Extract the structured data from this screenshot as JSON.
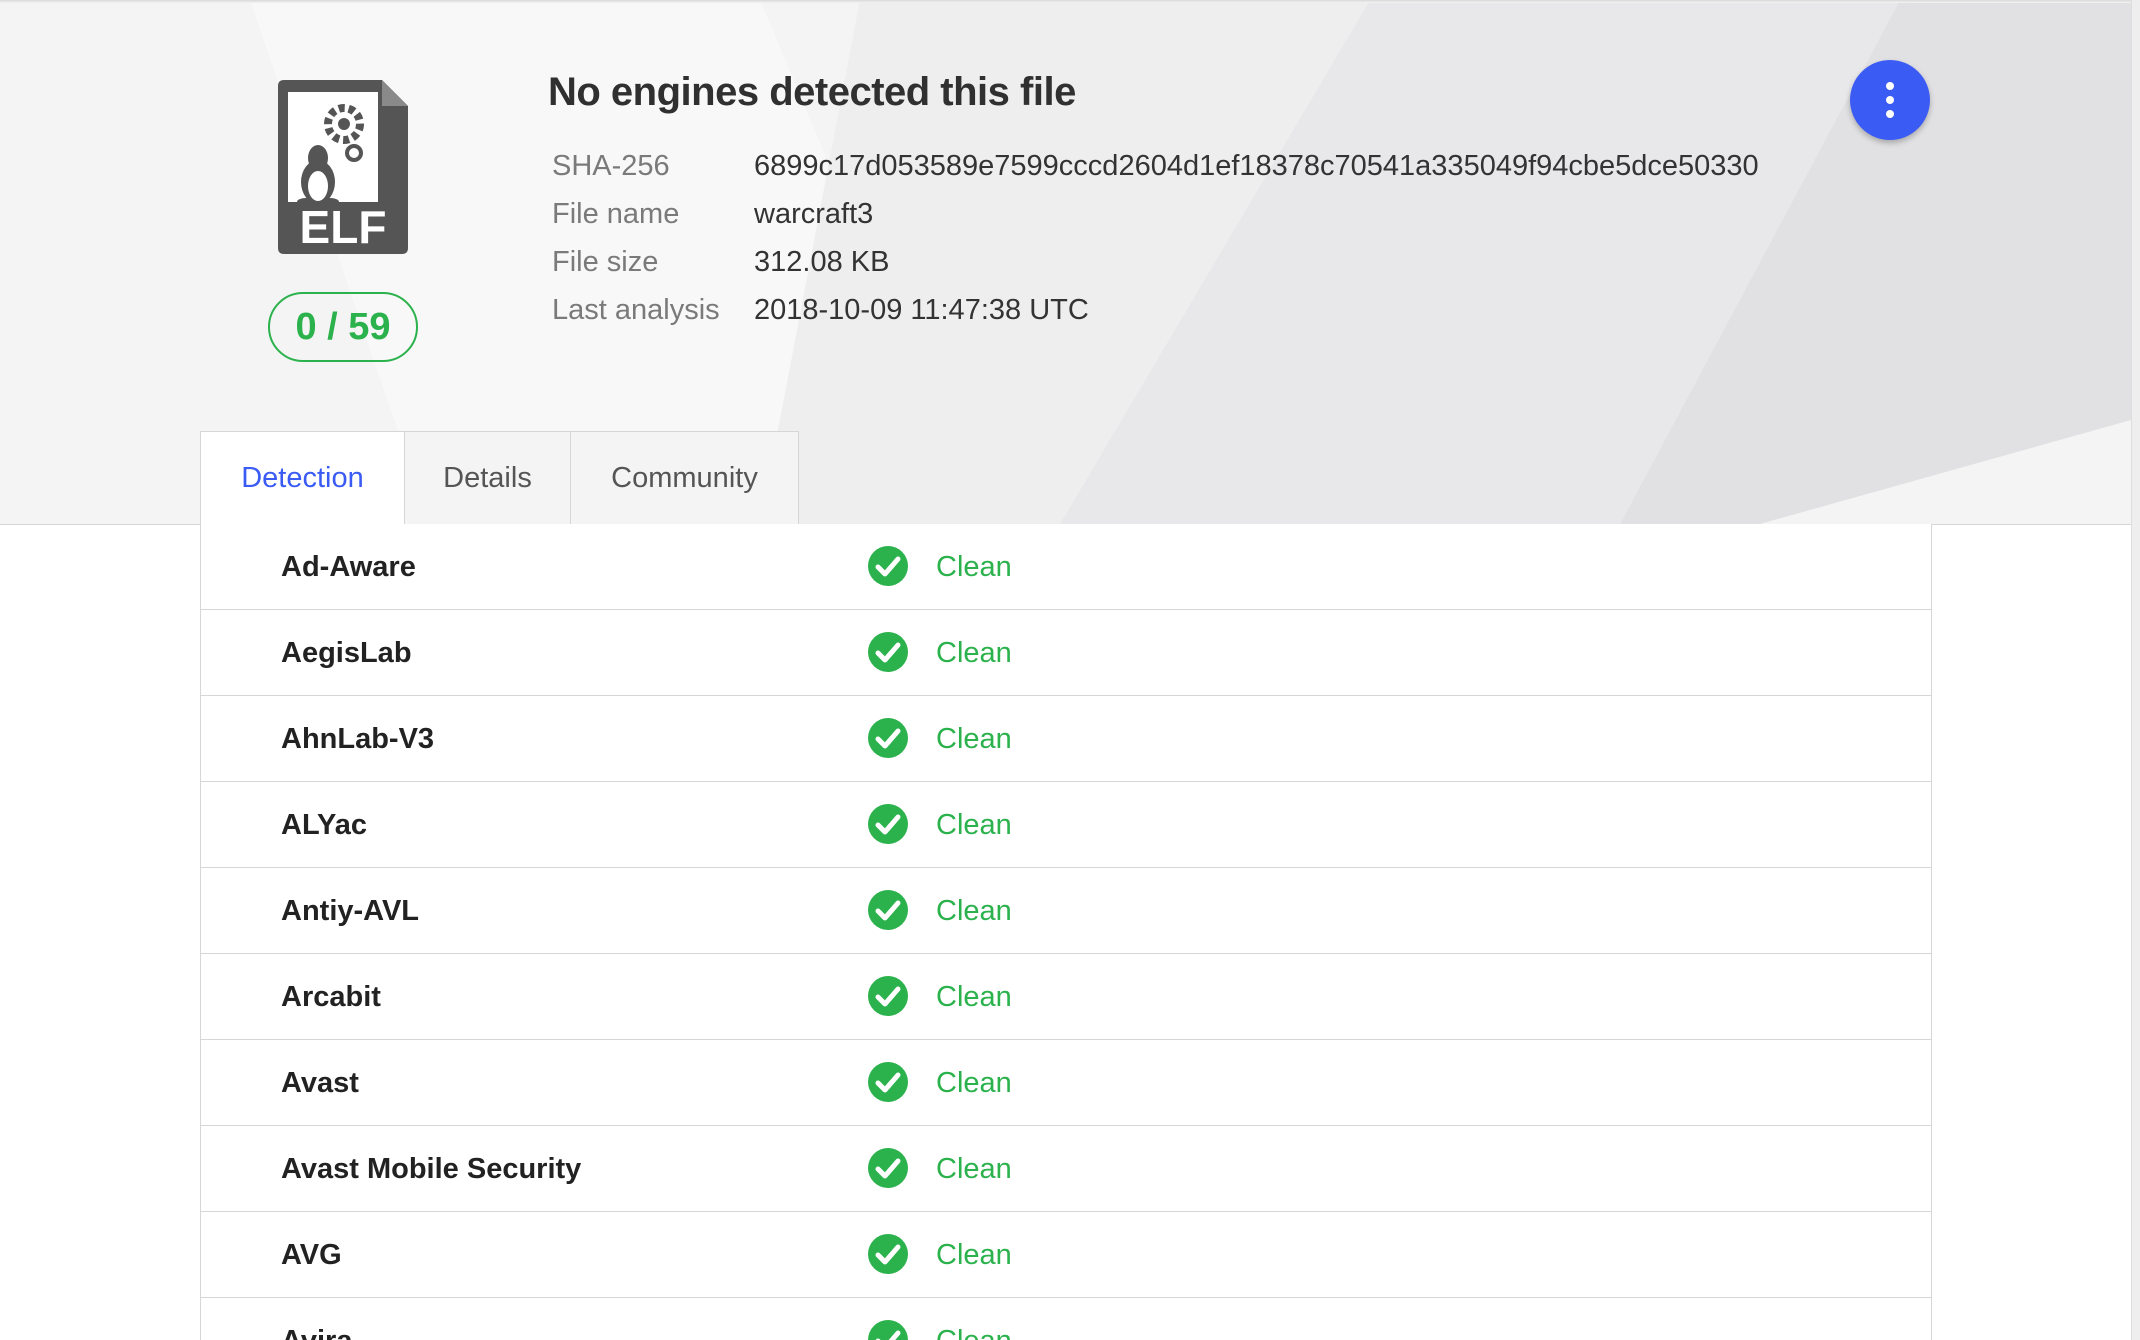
{
  "report": {
    "title": "No engines detected this file",
    "score": "0 / 59",
    "file_type": "ELF",
    "metadata": [
      {
        "label": "SHA-256",
        "value": "6899c17d053589e7599cccd2604d1ef18378c70541a335049f94cbe5dce50330"
      },
      {
        "label": "File name",
        "value": "warcraft3"
      },
      {
        "label": "File size",
        "value": "312.08 KB"
      },
      {
        "label": "Last analysis",
        "value": "2018-10-09 11:47:38 UTC"
      }
    ]
  },
  "actions": {
    "more_icon": "vertical-dots-icon"
  },
  "tabs": [
    {
      "label": "Detection",
      "active": true
    },
    {
      "label": "Details",
      "active": false
    },
    {
      "label": "Community",
      "active": false
    }
  ],
  "detections": [
    {
      "engine": "Ad-Aware",
      "result": "Clean"
    },
    {
      "engine": "AegisLab",
      "result": "Clean"
    },
    {
      "engine": "AhnLab-V3",
      "result": "Clean"
    },
    {
      "engine": "ALYac",
      "result": "Clean"
    },
    {
      "engine": "Antiy-AVL",
      "result": "Clean"
    },
    {
      "engine": "Arcabit",
      "result": "Clean"
    },
    {
      "engine": "Avast",
      "result": "Clean"
    },
    {
      "engine": "Avast Mobile Security",
      "result": "Clean"
    },
    {
      "engine": "AVG",
      "result": "Clean"
    },
    {
      "engine": "Avira",
      "result": "Clean"
    }
  ],
  "colors": {
    "accent": "#3b5bf5",
    "clean": "#2bb24c",
    "icon": "#555555"
  }
}
